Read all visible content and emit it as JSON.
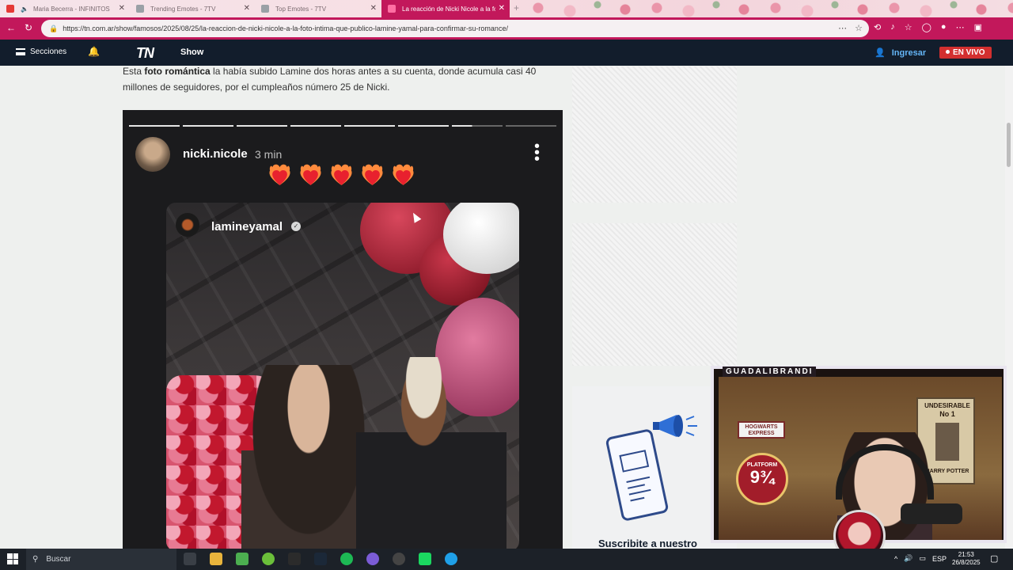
{
  "browser": {
    "tabs": [
      {
        "label": "Maria Becerra - INFINITOS",
        "icon": "youtube-icon",
        "color": "#e53935"
      },
      {
        "label": "Trending Emotes - 7TV",
        "icon": "7tv-icon",
        "color": "#9aa0a6"
      },
      {
        "label": "Top Emotes - 7TV",
        "icon": "7tv-icon",
        "color": "#9aa0a6"
      },
      {
        "label": "La reacción de Nicki Nicole a la fo",
        "icon": "tn-icon",
        "color": "#c2185b"
      }
    ],
    "url": "https://tn.com.ar/show/famosos/2025/08/25/la-reaccion-de-nicki-nicole-a-la-foto-intima-que-publico-lamine-yamal-para-confirmar-su-romance/",
    "accent": "#c2185b"
  },
  "site": {
    "sections_label": "Secciones",
    "logo": "TN",
    "section": "Show",
    "login_label": "Ingresar",
    "live_label": "EN VIVO"
  },
  "article": {
    "p1_start": "Esta ",
    "p1_bold": "foto romántica",
    "p1_end": " la había subido Lamine dos horas antes a su cuenta, donde acumula casi 40 millones de seguidores, por el cumpleaños número 25 de Nicki."
  },
  "story": {
    "username": "nicki.nicole",
    "time": "3 min",
    "hearts": 5,
    "inner_username": "lamineyamal"
  },
  "sidebar": {
    "newsletter_title": "Suscribite a nuestro"
  },
  "webcam": {
    "label": "GUADALIBRANDI",
    "poster_title": "UNDESIRABLE",
    "poster_no": "No 1",
    "poster_name": "HARRY POTTER",
    "platform_label": "PLATFORM",
    "platform_number": "9¾",
    "express_label": "HOGWARTS EXPRESS"
  },
  "taskbar": {
    "search_placeholder": "Buscar",
    "language": "ESP",
    "time": "21:53",
    "date": "26/8/2025"
  }
}
